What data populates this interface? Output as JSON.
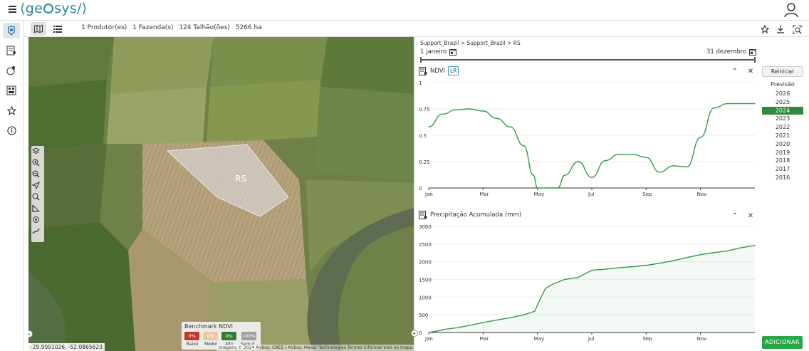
{
  "app": {
    "logo_text_left": "ge",
    "logo_text_right": "sys",
    "logo_brackets": "⟨ ⟩"
  },
  "subbar": {
    "producers": "1 Produtor(es)",
    "farms": "1 Fazenda(s)",
    "fields": "124 Talhão(ões)",
    "area": "5266 ha"
  },
  "map": {
    "field_label": "RS",
    "coordinates": "-29.9091026, -52.0865623",
    "attribution": "Imagens © 2024 Airbus, CNES / Airbus, Maxar Technologies   Termos   Informar erro no mapa",
    "benchmark": {
      "title": "Benchmark NDVI",
      "items": [
        {
          "value": "0%",
          "label": "Baixo",
          "color": "#c0392b"
        },
        {
          "value": "0%",
          "label": "Médio",
          "color": "#e8c9a0"
        },
        {
          "value": "0%",
          "label": "Alto",
          "color": "#2e7d32"
        },
        {
          "value": "100%",
          "label": "Sem d...",
          "color": "#9e9e9e"
        }
      ]
    }
  },
  "panel": {
    "breadcrumb": "Support_Brazil > Support_Brazil > RS",
    "date_start": "1 janeiro",
    "date_end": "31 dezembro",
    "reset_label": "Reiniciar",
    "forecast_label": "Previsão",
    "years": [
      "2026",
      "2025",
      "2024",
      "2023",
      "2022",
      "2021",
      "2020",
      "2019",
      "2018",
      "2017",
      "2016"
    ],
    "selected_year": "2024",
    "add_label": "ADICIONAR"
  },
  "chart_data": [
    {
      "type": "line",
      "title": "NDVI",
      "badge": "LR",
      "color": "#2e9a44",
      "x_ticks": [
        "Jan",
        "Mar",
        "May",
        "Jul",
        "Sep",
        "Nov"
      ],
      "y_ticks": [
        "0",
        "0.25",
        "0.5",
        "0.75",
        "1"
      ],
      "ylim": [
        0,
        1
      ],
      "x": [
        0,
        0.5,
        1,
        1.5,
        2,
        2.5,
        3,
        3.5,
        3.85,
        4,
        4.5,
        4.75,
        5,
        5.5,
        6,
        6.5,
        7,
        7.5,
        8,
        8.5,
        9,
        9.5,
        10,
        10.5,
        11,
        11.5,
        12
      ],
      "values": [
        0.58,
        0.7,
        0.74,
        0.75,
        0.73,
        0.66,
        0.58,
        0.4,
        0.12,
        0.0,
        0.0,
        0.0,
        0.12,
        0.25,
        0.1,
        0.26,
        0.32,
        0.32,
        0.29,
        0.15,
        0.21,
        0.2,
        0.48,
        0.76,
        0.8,
        0.8,
        0.8
      ]
    },
    {
      "type": "area",
      "title": "Precipitação Acumulada (mm)",
      "color": "#2e9a44",
      "x_ticks": [
        "Jan",
        "Mar",
        "May",
        "Jul",
        "Sep",
        "Nov"
      ],
      "y_ticks": [
        "0",
        "500",
        "1000",
        "1500",
        "2000",
        "2500",
        "3000"
      ],
      "ylim": [
        0,
        3000
      ],
      "x": [
        0,
        0.3,
        0.6,
        1,
        1.5,
        2,
        2.5,
        3,
        3.5,
        3.9,
        4.1,
        4.3,
        4.6,
        5,
        5.5,
        6,
        6.5,
        7,
        7.5,
        8,
        8.5,
        9,
        9.5,
        10,
        10.5,
        11,
        11.5,
        12
      ],
      "values": [
        0,
        40,
        90,
        130,
        200,
        280,
        350,
        420,
        500,
        600,
        950,
        1250,
        1380,
        1500,
        1560,
        1760,
        1790,
        1830,
        1860,
        1900,
        1960,
        2030,
        2120,
        2200,
        2260,
        2310,
        2400,
        2460
      ]
    }
  ]
}
